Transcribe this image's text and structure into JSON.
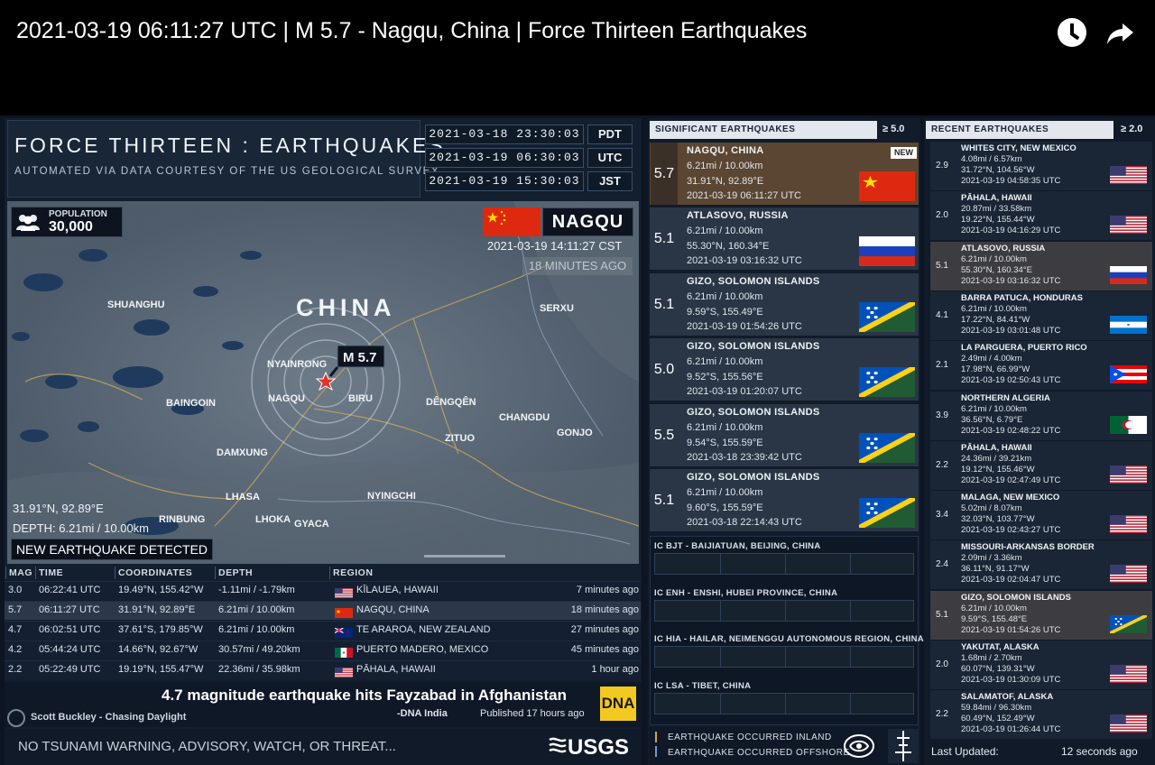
{
  "video": {
    "title": "2021-03-19 06:11:27 UTC | M 5.7 - Nagqu, China | Force Thirteen Earthquakes"
  },
  "brand": {
    "name": "FORCE THIRTEEN : EARTHQUAKES",
    "subtitle": "AUTOMATED VIA DATA COURTESY OF THE US GEOLOGICAL SURVEY"
  },
  "clocks": [
    {
      "time": "2021-03-18 23:30:03",
      "zone": "PDT"
    },
    {
      "time": "2021-03-19 06:30:03",
      "zone": "UTC"
    },
    {
      "time": "2021-03-19 15:30:03",
      "zone": "JST"
    }
  ],
  "map": {
    "population_label": "POPULATION",
    "population_value": "30,000",
    "location_name": "NAGQU",
    "local_time": "2021-03-19 14:11:27 CST",
    "ago": "18 MINUTES AGO",
    "country_label": "CHINA",
    "marker_label": "M 5.7",
    "coords": "31.91°N, 92.89°E",
    "depth": "DEPTH: 6.21mi / 10.00km",
    "banner": "NEW EARTHQUAKE DETECTED",
    "places": [
      "SHUANGHU",
      "SERXU",
      "NYAINRONG",
      "BAINGOIN",
      "NAGQU",
      "BIRU",
      "DÊNGQÊN",
      "CHANGDU",
      "ZITUO",
      "GONJO",
      "DAMXUNG",
      "LHASA",
      "NYINGCHI",
      "RINBUNG",
      "LHOKA",
      "GYACA"
    ],
    "colors": {
      "flag_red": "#de2910",
      "star": "#e0342a"
    }
  },
  "table": {
    "headers": [
      "MAG",
      "TIME",
      "COORDINATES",
      "DEPTH",
      "REGION"
    ],
    "rows": [
      {
        "mag": "3.0",
        "time": "06:22:41 UTC",
        "coords": "19.49°N, 155.42°W",
        "depth": "-1.11mi / -1.79km",
        "region": "KĪLAUEA, HAWAII",
        "ago": "7 minutes ago",
        "flag": "us"
      },
      {
        "mag": "5.7",
        "time": "06:11:27 UTC",
        "coords": "31.91°N, 92.89°E",
        "depth": "6.21mi / 10.00km",
        "region": "NAGQU, CHINA",
        "ago": "18 minutes ago",
        "flag": "cn"
      },
      {
        "mag": "4.7",
        "time": "06:02:51 UTC",
        "coords": "37.61°S, 179.85°W",
        "depth": "6.21mi / 10.00km",
        "region": "TE ARAROA, NEW ZEALAND",
        "ago": "27 minutes ago",
        "flag": "nz"
      },
      {
        "mag": "4.2",
        "time": "05:44:24 UTC",
        "coords": "14.66°N, 92.67°W",
        "depth": "30.57mi / 49.20km",
        "region": "PUERTO MADERO, MEXICO",
        "ago": "45 minutes ago",
        "flag": "mx"
      },
      {
        "mag": "2.2",
        "time": "05:22:49 UTC",
        "coords": "19.19°N, 155.47°W",
        "depth": "22.36mi / 35.98km",
        "region": "PĀHALA, HAWAII",
        "ago": "1 hour ago",
        "flag": "us"
      }
    ]
  },
  "ticker": {
    "music": "Scott Buckley - Chasing Daylight",
    "headline": "4.7 magnitude earthquake hits Fayzabad in Afghanistan",
    "source": "-DNA India",
    "published": "Published 17 hours ago",
    "source_logo": "DNA"
  },
  "bottom": {
    "tsunami": "NO TSUNAMI WARNING, ADVISORY, WATCH, OR THREAT...",
    "logo": "USGS"
  },
  "significant": {
    "title": "SIGNIFICANT EARTHQUAKES",
    "min": "≥ 5.0",
    "new_badge": "NEW",
    "items": [
      {
        "mag": "5.7",
        "place": "NAGQU, CHINA",
        "depth": "6.21mi / 10.00km",
        "coords": "31.91°N, 92.89°E",
        "time": "2021-03-19 06:11:27 UTC",
        "flag": "cn"
      },
      {
        "mag": "5.1",
        "place": "ATLASOVO, RUSSIA",
        "depth": "6.21mi / 10.00km",
        "coords": "55.30°N, 160.34°E",
        "time": "2021-03-19 03:16:32 UTC",
        "flag": "ru"
      },
      {
        "mag": "5.1",
        "place": "GIZO, SOLOMON ISLANDS",
        "depth": "6.21mi / 10.00km",
        "coords": "9.59°S, 155.49°E",
        "time": "2021-03-19 01:54:26 UTC",
        "flag": "sb"
      },
      {
        "mag": "5.0",
        "place": "GIZO, SOLOMON ISLANDS",
        "depth": "6.21mi / 10.00km",
        "coords": "9.52°S, 155.56°E",
        "time": "2021-03-19 01:20:07 UTC",
        "flag": "sb"
      },
      {
        "mag": "5.5",
        "place": "GIZO, SOLOMON ISLANDS",
        "depth": "6.21mi / 10.00km",
        "coords": "9.54°S, 155.59°E",
        "time": "2021-03-18 23:39:42 UTC",
        "flag": "sb"
      },
      {
        "mag": "5.1",
        "place": "GIZO, SOLOMON ISLANDS",
        "depth": "6.21mi / 10.00km",
        "coords": "9.60°S, 155.59°E",
        "time": "2021-03-18 22:14:43 UTC",
        "flag": "sb"
      }
    ]
  },
  "stations": [
    "IC BJT - BAIJIATUAN, BEIJING, CHINA",
    "IC ENH - ENSHI, HUBEI PROVINCE, CHINA",
    "IC HIA - HAILAR, NEIMENGGU AUTONOMOUS REGION, CHINA",
    "IC LSA - TIBET, CHINA"
  ],
  "legend": {
    "inland": "EARTHQUAKE OCCURRED INLAND",
    "offshore": "EARTHQUAKE OCCURRED OFFSHORE"
  },
  "recent": {
    "title": "RECENT EARTHQUAKES",
    "min": "≥ 2.0",
    "items": [
      {
        "mag": "2.9",
        "place": "WHITES CITY, NEW MEXICO",
        "depth": "4.08mi / 6.57km",
        "coords": "31.72°N, 104.56°W",
        "time": "2021-03-19 04:58:35 UTC",
        "flag": "us"
      },
      {
        "mag": "2.0",
        "place": "PĀHALA, HAWAII",
        "depth": "20.87mi / 33.58km",
        "coords": "19.22°N, 155.44°W",
        "time": "2021-03-19 04:16:29 UTC",
        "flag": "us"
      },
      {
        "mag": "5.1",
        "place": "ATLASOVO, RUSSIA",
        "depth": "6.21mi / 10.00km",
        "coords": "55.30°N, 160.34°E",
        "time": "2021-03-19 03:16:32 UTC",
        "flag": "ru"
      },
      {
        "mag": "4.1",
        "place": "BARRA PATUCA, HONDURAS",
        "depth": "6.21mi / 10.00km",
        "coords": "17.22°N, 84.41°W",
        "time": "2021-03-19 03:01:48 UTC",
        "flag": "hn"
      },
      {
        "mag": "2.1",
        "place": "LA PARGUERA, PUERTO RICO",
        "depth": "2.49mi / 4.00km",
        "coords": "17.98°N, 66.99°W",
        "time": "2021-03-19 02:50:43 UTC",
        "flag": "pr"
      },
      {
        "mag": "3.9",
        "place": "NORTHERN ALGERIA",
        "depth": "6.21mi / 10.00km",
        "coords": "36.56°N, 6.79°E",
        "time": "2021-03-19 02:48:22 UTC",
        "flag": "dz"
      },
      {
        "mag": "2.2",
        "place": "PĀHALA, HAWAII",
        "depth": "24.36mi / 39.21km",
        "coords": "19.12°N, 155.46°W",
        "time": "2021-03-19 02:47:49 UTC",
        "flag": "us"
      },
      {
        "mag": "3.4",
        "place": "MALAGA, NEW MEXICO",
        "depth": "5.02mi / 8.07km",
        "coords": "32.03°N, 103.77°W",
        "time": "2021-03-19 02:43:27 UTC",
        "flag": "us"
      },
      {
        "mag": "2.4",
        "place": "MISSOURI-ARKANSAS BORDER",
        "depth": "2.09mi / 3.36km",
        "coords": "36.11°N, 91.17°W",
        "time": "2021-03-19 02:04:47 UTC",
        "flag": "us"
      },
      {
        "mag": "5.1",
        "place": "GIZO, SOLOMON ISLANDS",
        "depth": "6.21mi / 10.00km",
        "coords": "9.59°S, 155.48°E",
        "time": "2021-03-19 01:54:26 UTC",
        "flag": "sb"
      },
      {
        "mag": "2.0",
        "place": "YAKUTAT, ALASKA",
        "depth": "1.68mi / 2.70km",
        "coords": "60.07°N, 139.31°W",
        "time": "2021-03-19 01:30:09 UTC",
        "flag": "us"
      },
      {
        "mag": "2.2",
        "place": "SALAMATOF, ALASKA",
        "depth": "59.84mi / 96.30km",
        "coords": "60.49°N, 152.49°W",
        "time": "2021-03-19 01:26:44 UTC",
        "flag": "us"
      }
    ],
    "last_updated_label": "Last Updated:",
    "last_updated_value": "12 seconds ago"
  }
}
